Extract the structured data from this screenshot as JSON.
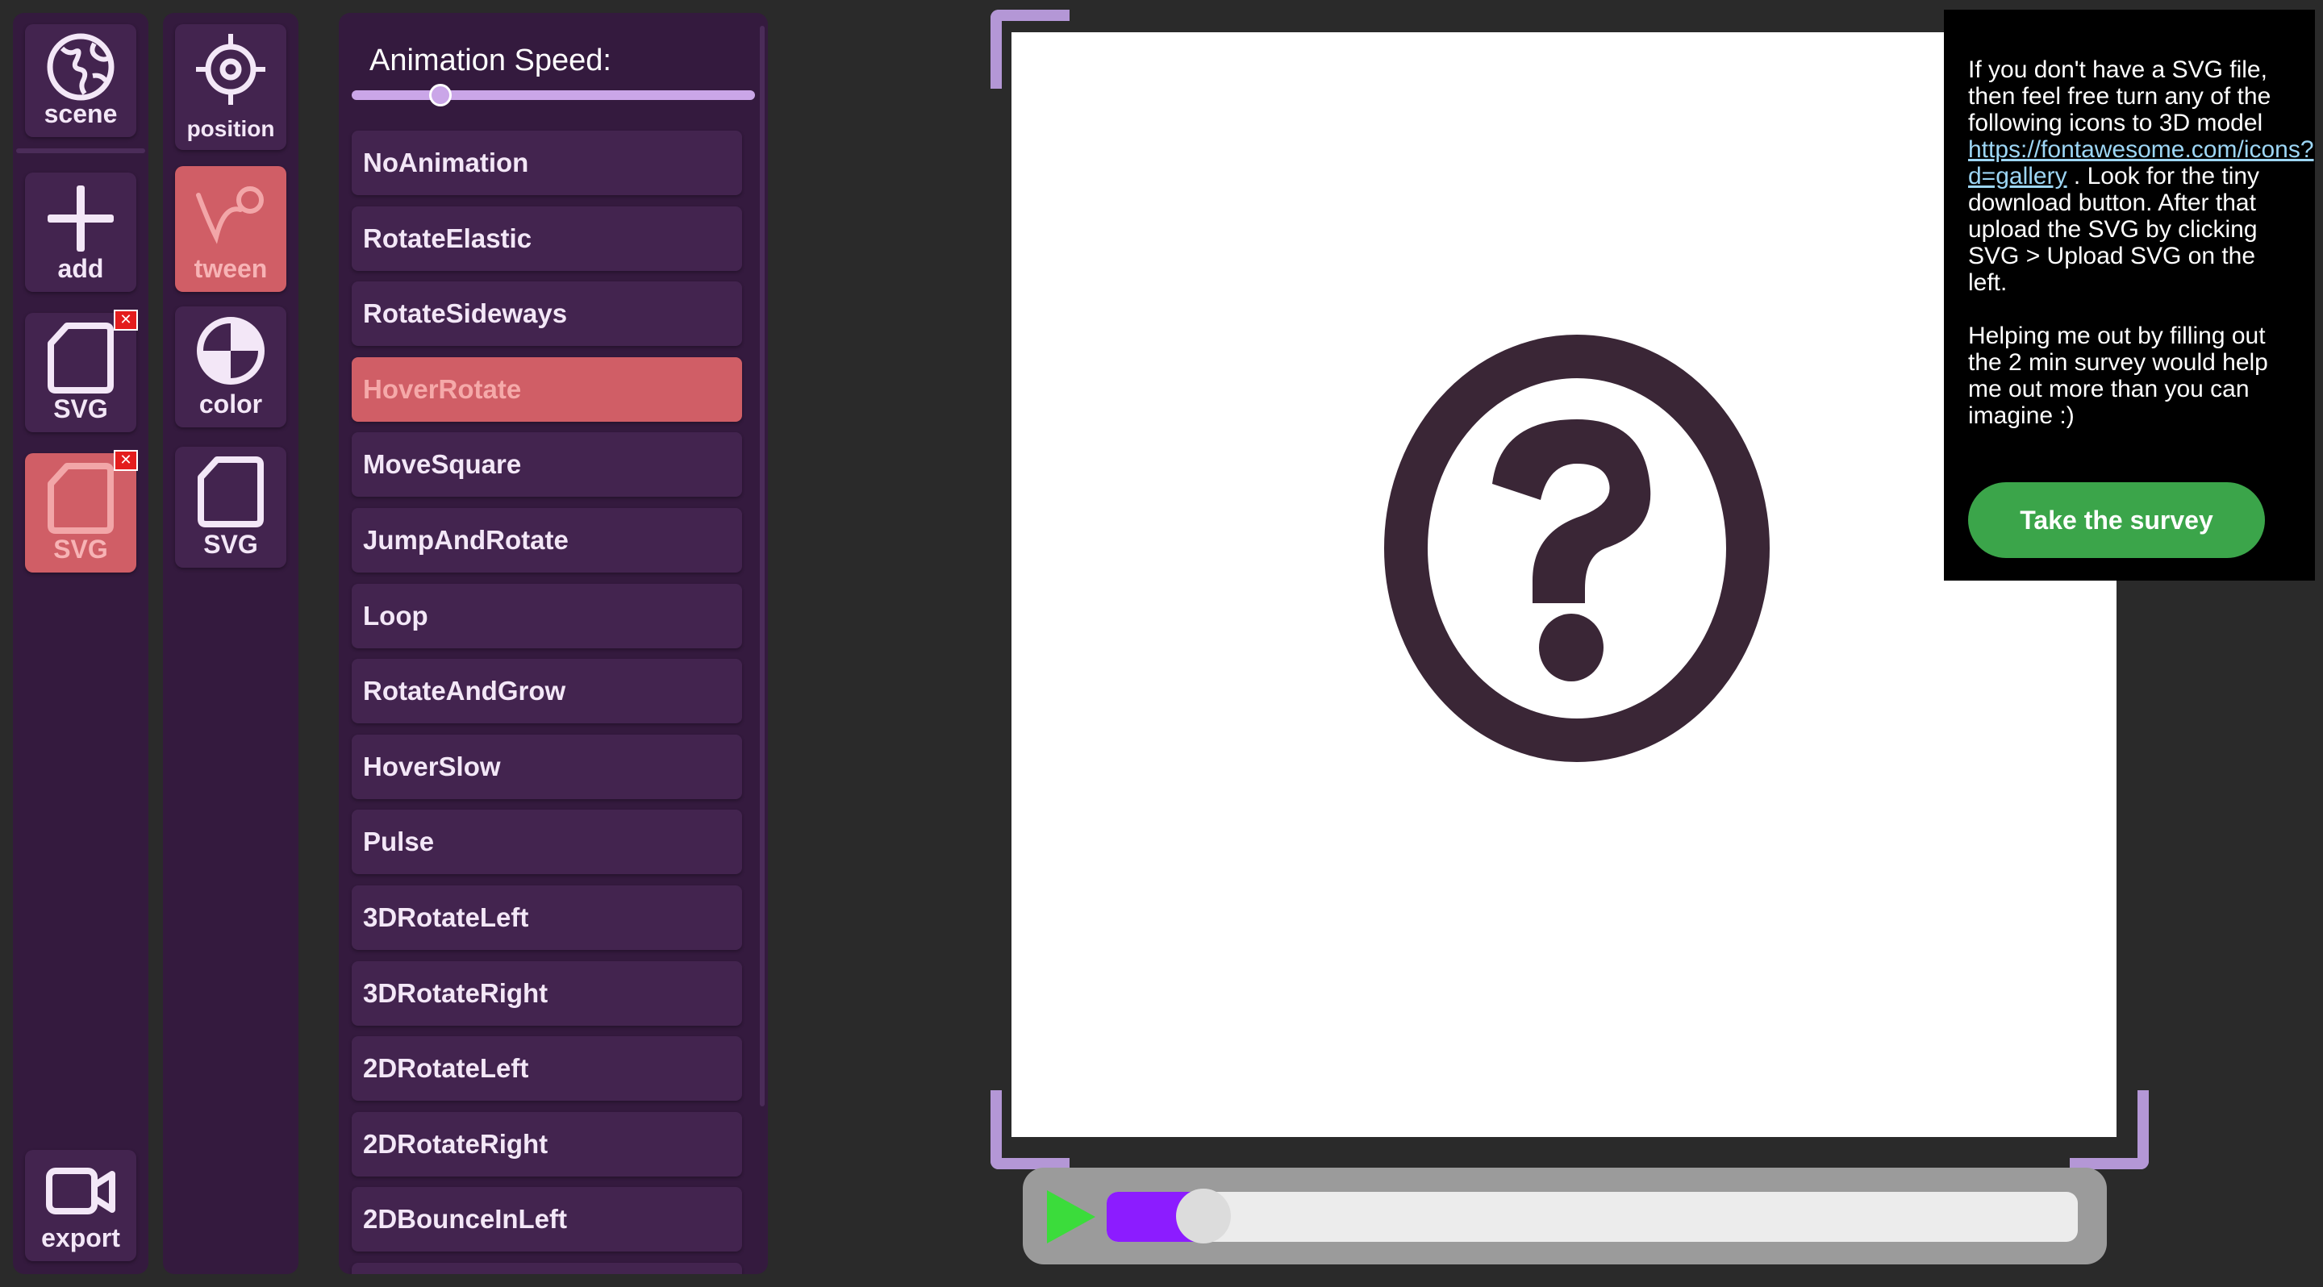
{
  "sidebar_left": {
    "scene_label": "scene",
    "add_label": "add",
    "svg1_label": "SVG",
    "svg2_label": "SVG",
    "export_label": "export",
    "remove_symbol": "✕"
  },
  "sidebar_props": {
    "position_label": "position",
    "tween_label": "tween",
    "color_label": "color",
    "svg_label": "SVG"
  },
  "animation_panel": {
    "speed_label": "Animation Speed:",
    "speed_value": 0.22,
    "items": [
      {
        "label": "NoAnimation"
      },
      {
        "label": "RotateElastic"
      },
      {
        "label": "RotateSideways"
      },
      {
        "label": "HoverRotate",
        "active": true
      },
      {
        "label": "MoveSquare"
      },
      {
        "label": "JumpAndRotate"
      },
      {
        "label": "Loop"
      },
      {
        "label": "RotateAndGrow"
      },
      {
        "label": "HoverSlow"
      },
      {
        "label": "Pulse"
      },
      {
        "label": "3DRotateLeft"
      },
      {
        "label": "3DRotateRight"
      },
      {
        "label": "2DRotateLeft"
      },
      {
        "label": "2DRotateRight"
      },
      {
        "label": "2DBounceInLeft"
      },
      {
        "label": ""
      }
    ]
  },
  "viewport": {
    "model_icon": "question-circle-icon",
    "model_color": "#3a2636"
  },
  "info": {
    "line1": "If you don't have a SVG file, then feel free turn any of the following icons to 3D model",
    "link_text": "https://fontawesome.com/icons?d=gallery",
    "line2": " . Look for the tiny download button. After that upload the SVG by clicking SVG > Upload SVG on the left.",
    "paragraph2": "Helping me out by filling out the 2 min survey would help me out more than you can imagine :)",
    "survey_button": "Take the survey"
  },
  "player": {
    "progress": 0.05
  },
  "colors": {
    "panel": "#341a3e",
    "item": "#43244f",
    "active": "#d05e66",
    "accent": "#b497d6",
    "survey_green": "#3ba54a",
    "progress_fill": "#8c1cff"
  }
}
